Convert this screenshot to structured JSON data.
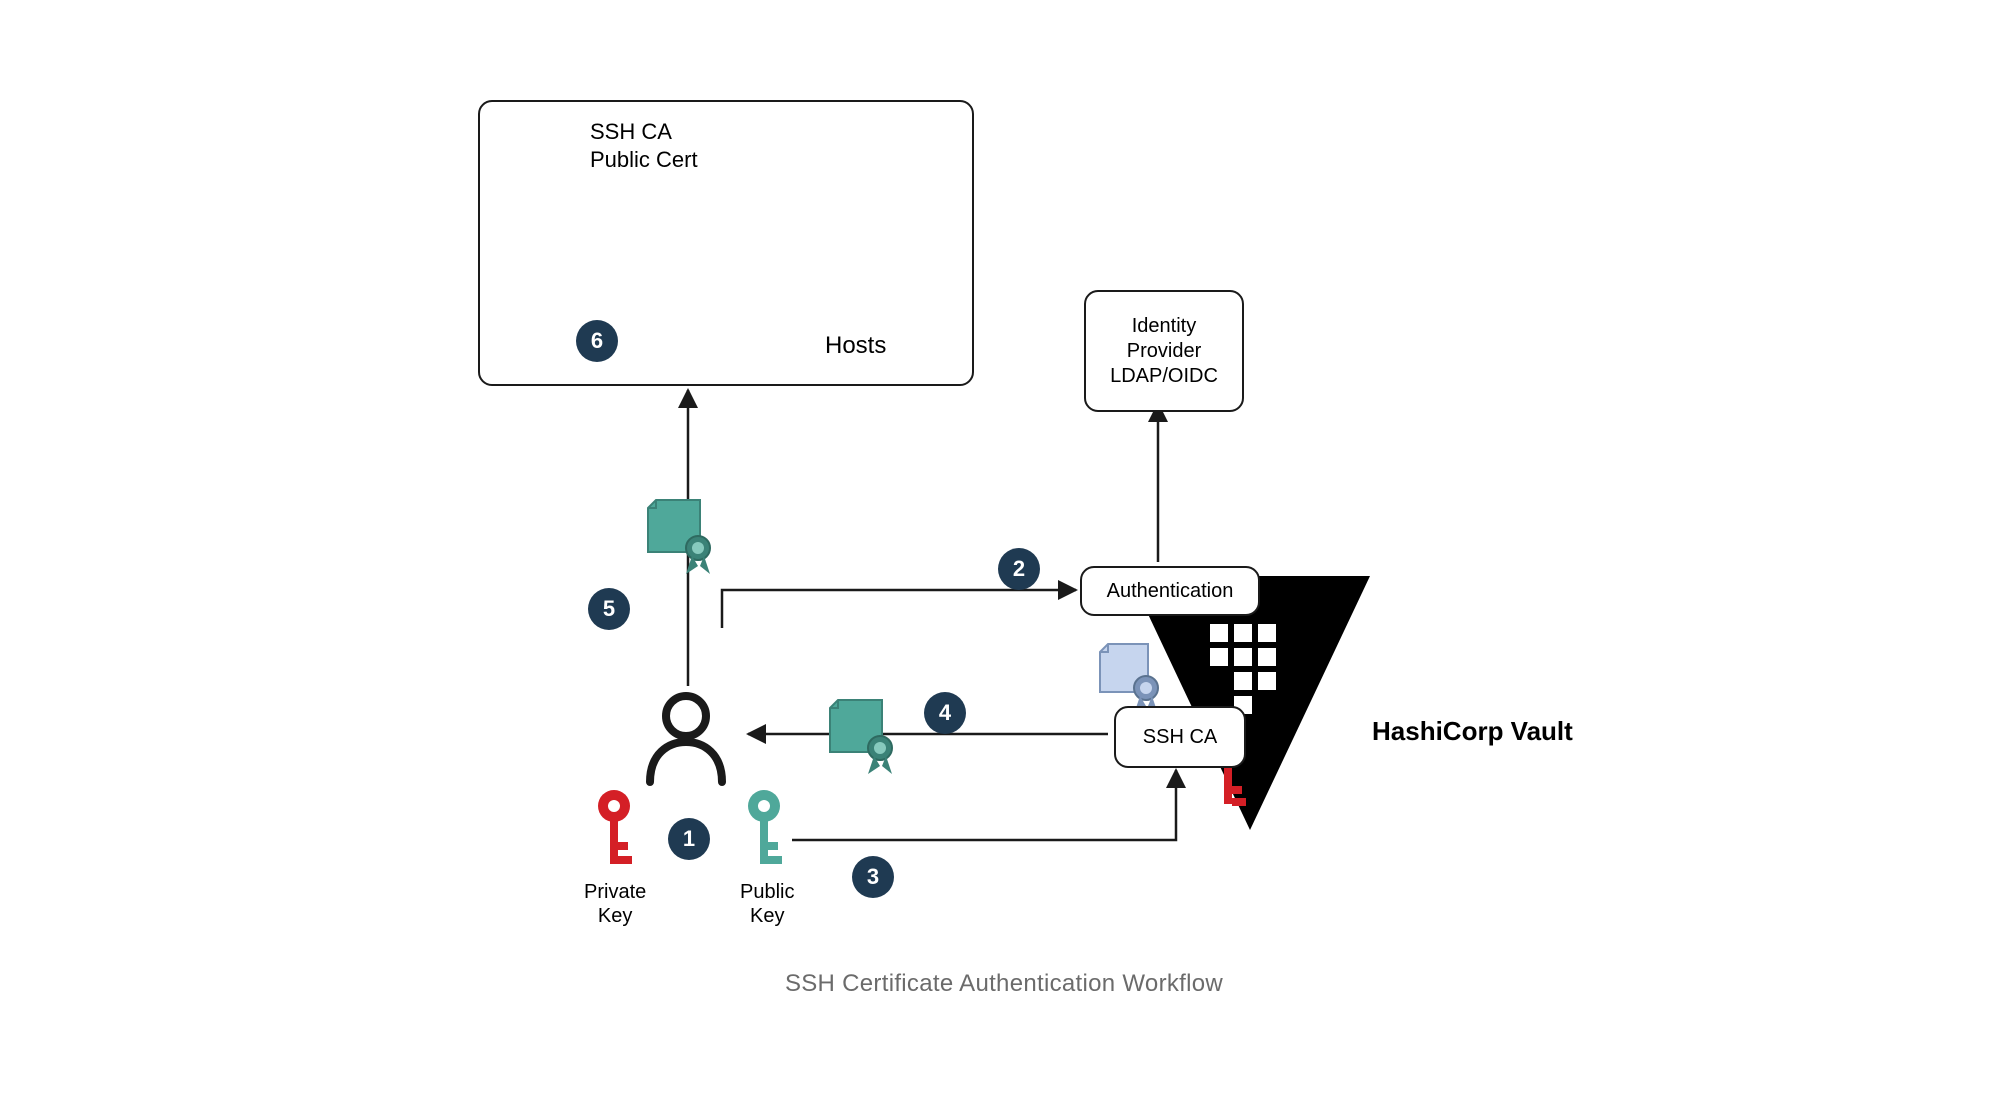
{
  "caption": "SSH Certificate Authentication Workflow",
  "nodes": {
    "hosts_title": "Hosts",
    "ssh_ca_cert_label_line1": "SSH CA",
    "ssh_ca_cert_label_line2": "Public Cert",
    "idp_line1": "Identity",
    "idp_line2": "Provider",
    "idp_line3": "LDAP/OIDC",
    "authentication": "Authentication",
    "ssh_ca": "SSH CA",
    "vault": "HashiCorp Vault",
    "private_key_line1": "Private",
    "private_key_line2": "Key",
    "public_key_line1": "Public",
    "public_key_line2": "Key"
  },
  "steps": {
    "s1": "1",
    "s2": "2",
    "s3": "3",
    "s4": "4",
    "s5": "5",
    "s6": "6"
  },
  "colors": {
    "badge": "#1f3a52",
    "teal": "#4fa89a",
    "red": "#d41f26",
    "blue_cert": "#c6d5ee",
    "server_gray": "#e8e8e8"
  }
}
